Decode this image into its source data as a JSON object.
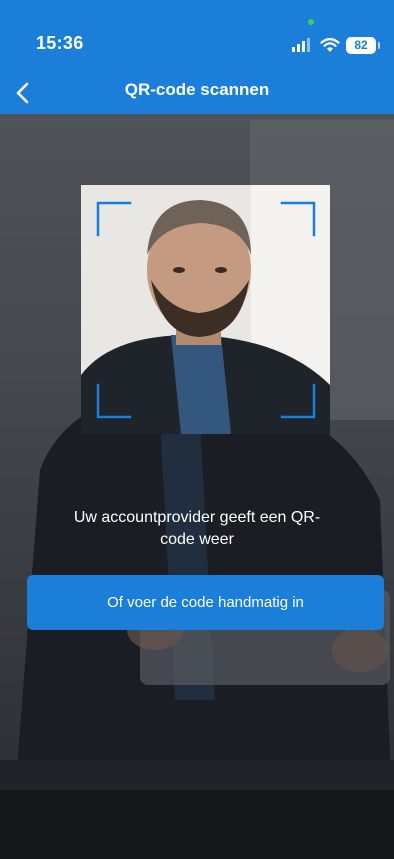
{
  "status_bar": {
    "time": "15:36",
    "battery_level": "82",
    "icons": [
      "signal-icon",
      "wifi-icon",
      "battery-icon"
    ]
  },
  "app_bar": {
    "title": "QR-code scannen",
    "back_icon": "chevron-left-icon"
  },
  "scanner": {
    "instruction_line1": "Uw accountprovider geeft een QR-",
    "instruction_line2": "code weer"
  },
  "actions": {
    "manual_entry_label": "Of voer de code handmatig in"
  },
  "colors": {
    "accent": "#1b7fd9",
    "status_dot": "#39d353",
    "text_on_accent": "#ffffff"
  }
}
